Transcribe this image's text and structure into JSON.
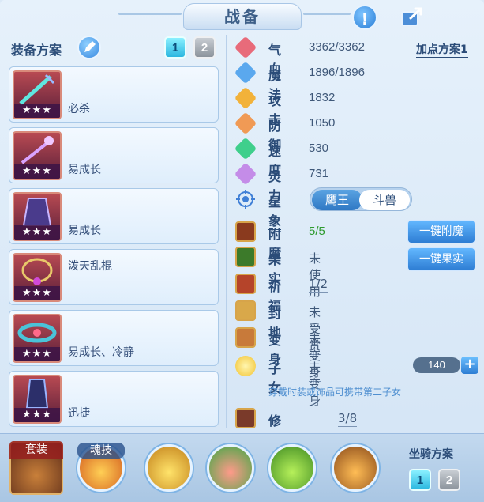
{
  "window": {
    "title": "战备"
  },
  "equip_plan": {
    "label": "装备方案",
    "plan_1": "1",
    "plan_2": "2",
    "slots": [
      {
        "name": "必杀",
        "stars": "★★★"
      },
      {
        "name": "易成长",
        "stars": "★★★"
      },
      {
        "name": "易成长",
        "stars": "★★★"
      },
      {
        "name": "泼天乱棍",
        "stars": "★★★"
      },
      {
        "name": "易成长、冷静",
        "stars": "★★★"
      },
      {
        "name": "迅捷",
        "stars": "★★★"
      }
    ]
  },
  "add_point_plan": "加点方案1",
  "stats": [
    {
      "label": "气血",
      "value": "3362/3362",
      "color": "#e86b7a"
    },
    {
      "label": "魔法",
      "value": "1896/1896",
      "color": "#5aa8ee"
    },
    {
      "label": "攻击",
      "value": "1832",
      "color": "#f2b23a"
    },
    {
      "label": "防御",
      "value": "1050",
      "color": "#f09a55"
    },
    {
      "label": "速度",
      "value": "530",
      "color": "#3fcf8c"
    },
    {
      "label": "灵力",
      "value": "731",
      "color": "#c48ce8"
    }
  ],
  "star_sign": {
    "label": "星象",
    "option_1": "鹰王",
    "option_2": "斗兽"
  },
  "extras": [
    {
      "label": "附魔",
      "value": "5/5"
    },
    {
      "label": "果实",
      "value": "未使用"
    },
    {
      "label": "祈福",
      "value": "1/2"
    },
    {
      "label": "封地",
      "value": "未受赏"
    },
    {
      "label": "变身",
      "value": "未变身"
    },
    {
      "label": "子女",
      "value": "未变身"
    },
    {
      "label": "修炼觉醒",
      "value": "3/8"
    }
  ],
  "buttons": {
    "enchant": "一键附魔",
    "fruit": "一键果实"
  },
  "child": {
    "count": "140",
    "plus": "+",
    "hint": "穿戴时装或饰品可携带第二子女"
  },
  "bottom": {
    "suit": "套装",
    "soul_skill": "魂技",
    "mount_plan": "坐骑方案",
    "mount_1": "1",
    "mount_2": "2"
  },
  "icons": {
    "hint": "!",
    "share": "share-icon"
  }
}
